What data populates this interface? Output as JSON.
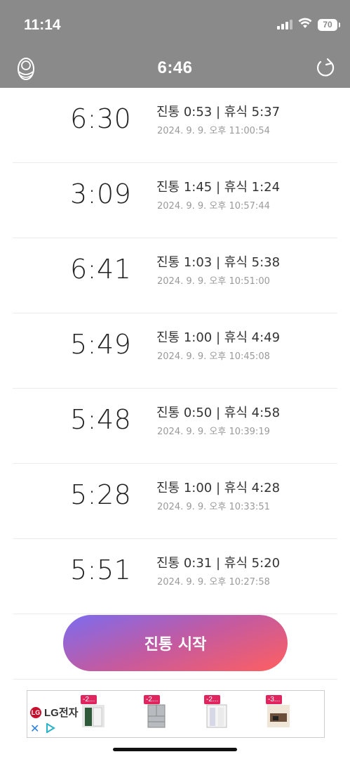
{
  "status": {
    "time": "11:14",
    "battery": "70"
  },
  "nav": {
    "title": "6:46"
  },
  "entries": [
    {
      "interval": "6:30",
      "detail": "진통 0:53 | 휴식 5:37",
      "timestamp": "2024. 9. 9. 오후 11:00:54"
    },
    {
      "interval": "3:09",
      "detail": "진통 1:45 | 휴식 1:24",
      "timestamp": "2024. 9. 9. 오후 10:57:44"
    },
    {
      "interval": "6:41",
      "detail": "진통 1:03 | 휴식 5:38",
      "timestamp": "2024. 9. 9. 오후 10:51:00"
    },
    {
      "interval": "5:49",
      "detail": "진통 1:00 | 휴식 4:49",
      "timestamp": "2024. 9. 9. 오후 10:45:08"
    },
    {
      "interval": "5:48",
      "detail": "진통 0:50 | 휴식 4:58",
      "timestamp": "2024. 9. 9. 오후 10:39:19"
    },
    {
      "interval": "5:28",
      "detail": "진통 1:00 | 휴식 4:28",
      "timestamp": "2024. 9. 9. 오후 10:33:51"
    },
    {
      "interval": "5:51",
      "detail": "진통 0:31 | 휴식 5:20",
      "timestamp": "2024. 9. 9. 오후 10:27:58"
    }
  ],
  "start_button": {
    "label": "진통 시작"
  },
  "ad": {
    "brand": "LG전자",
    "products": [
      {
        "badge": "-2..."
      },
      {
        "badge": "-2..."
      },
      {
        "badge": "-2..."
      },
      {
        "badge": "-3..."
      }
    ]
  },
  "colors": {
    "header": "#8a8a8a",
    "button_gradient_start": "#7b6cf0",
    "button_gradient_end": "#ff5f5f",
    "ad_badge": "#e0245e"
  }
}
